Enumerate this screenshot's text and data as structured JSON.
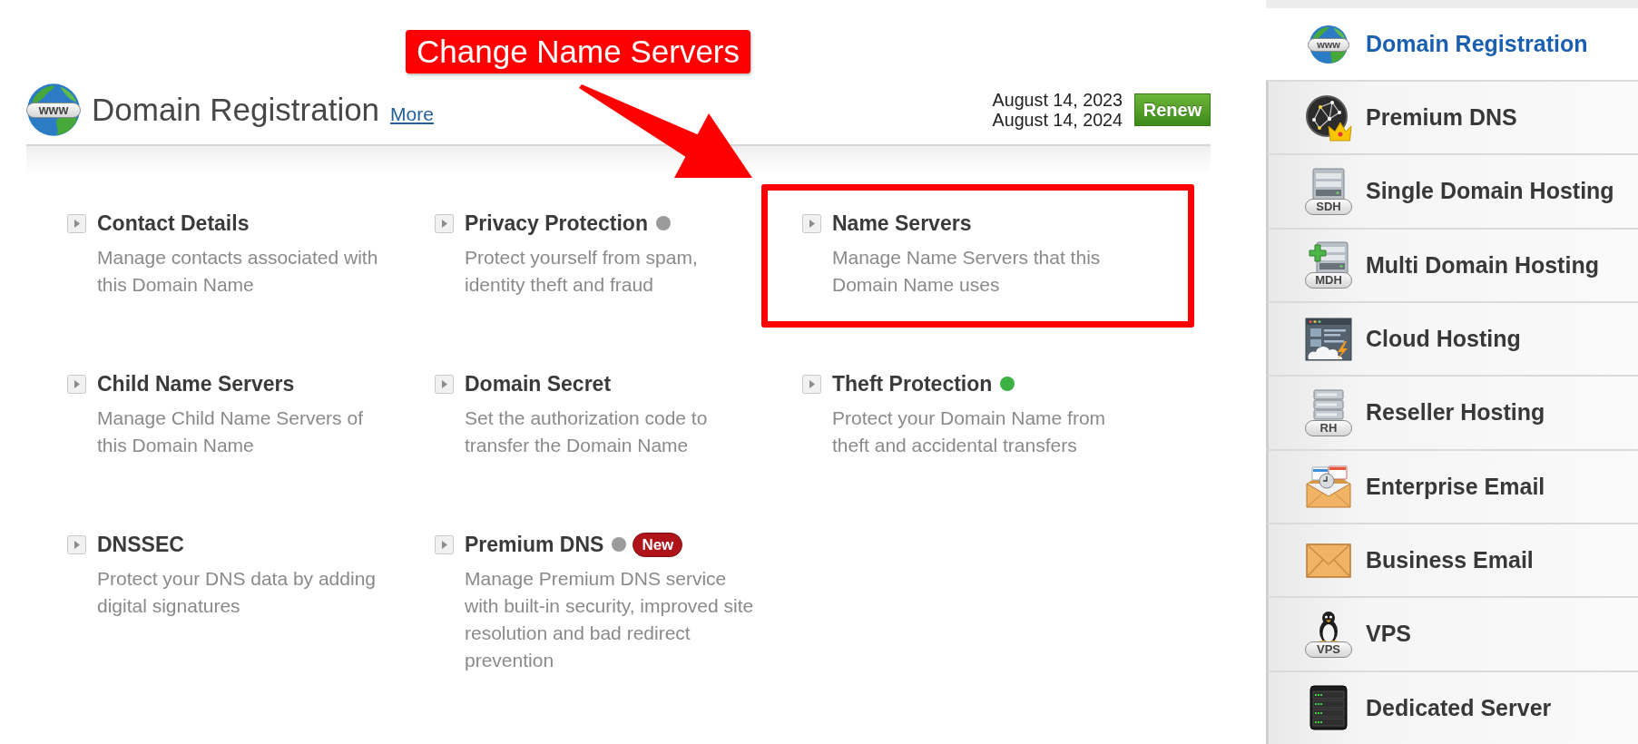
{
  "callout": {
    "label": "Change Name Servers"
  },
  "header": {
    "icon_label": "www",
    "title": "Domain Registration",
    "more_link": "More",
    "dates": [
      "August 14, 2023",
      "August 14, 2024"
    ],
    "renew_button": "Renew"
  },
  "features": [
    {
      "title": "Contact Details",
      "description": "Manage contacts associated with this Domain Name",
      "highlighted": false
    },
    {
      "title": "Privacy Protection",
      "description": "Protect yourself from spam, identity theft and fraud",
      "highlighted": false,
      "color": "#9b9b9b"
    },
    {
      "title": "Name Servers",
      "description": "Manage Name Servers that this Domain Name uses",
      "highlighted": true
    },
    {
      "title": "Child Name Servers",
      "description": "Manage Child Name Servers of this Domain Name",
      "highlighted": false
    },
    {
      "title": "Domain Secret",
      "description": "Set the authorization code to transfer the Domain Name",
      "highlighted": false
    },
    {
      "title": "Theft Protection",
      "description": "Protect your Domain Name from theft and accidental transfers",
      "highlighted": false,
      "color": "#3bb143"
    },
    {
      "title": "DNSSEC",
      "description": "Protect your DNS data by adding digital signatures",
      "highlighted": false
    },
    {
      "title": "Premium DNS",
      "description": "Manage Premium DNS service with built-in security, improved site resolution and bad redirect prevention",
      "highlighted": false,
      "color": "#9b9b9b",
      "badge": "New"
    }
  ],
  "sidebar": {
    "items": [
      {
        "label": "Domain Registration",
        "selected": true,
        "icon_label": "www"
      },
      {
        "label": "Premium DNS",
        "selected": false
      },
      {
        "label": "Single Domain Hosting",
        "selected": false,
        "icon_label": "SDH"
      },
      {
        "label": "Multi Domain Hosting",
        "selected": false,
        "icon_label": "MDH"
      },
      {
        "label": "Cloud Hosting",
        "selected": false
      },
      {
        "label": "Reseller Hosting",
        "selected": false,
        "icon_label": "RH"
      },
      {
        "label": "Enterprise Email",
        "selected": false
      },
      {
        "label": "Business Email",
        "selected": false
      },
      {
        "label": "VPS",
        "selected": false,
        "icon_label": "VPS"
      },
      {
        "label": "Dedicated Server",
        "selected": false
      }
    ]
  }
}
